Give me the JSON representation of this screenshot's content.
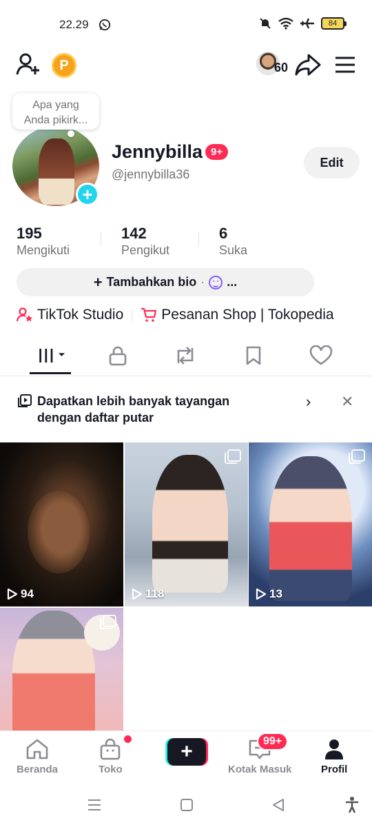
{
  "status_bar": {
    "time": "22.29",
    "battery": "84"
  },
  "header": {
    "visitor_count": "60"
  },
  "profile": {
    "thought_line1": "Apa yang",
    "thought_line2": "Anda pikirk...",
    "display_name": "Jennybilla",
    "name_badge": "9+",
    "username": "@jennybilla36",
    "edit_label": "Edit"
  },
  "stats": [
    {
      "value": "195",
      "label": "Mengikuti"
    },
    {
      "value": "142",
      "label": "Pengikut"
    },
    {
      "value": "6",
      "label": "Suka"
    }
  ],
  "bio": {
    "label": "Tambahkan bio",
    "more": "..."
  },
  "links": {
    "studio": "TikTok Studio",
    "shop": "Pesanan Shop | Tokopedia"
  },
  "banner": {
    "text": "Dapatkan lebih banyak tayangan dengan daftar putar"
  },
  "videos": [
    {
      "views": "94"
    },
    {
      "views": "118"
    },
    {
      "views": "13"
    },
    {
      "views": ""
    }
  ],
  "nav": {
    "home": "Beranda",
    "shop": "Toko",
    "inbox": "Kotak Masuk",
    "inbox_badge": "99+",
    "profile": "Profil"
  },
  "colors": {
    "accent": "#fe2c55",
    "cyan": "#20d5ec"
  }
}
